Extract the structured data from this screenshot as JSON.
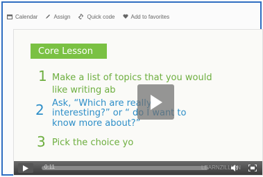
{
  "toolbar": {
    "calendar": "Calendar",
    "assign": "Assign",
    "quick_code": "Quick code",
    "favorites": "Add to favorites"
  },
  "lesson": {
    "tag": "Core Lesson",
    "steps": [
      {
        "num": "1",
        "lines": [
          "Make a list of topics that you would",
          "like writing ab"
        ]
      },
      {
        "num": "2",
        "lines": [
          "Ask, “Which          are really",
          "interesting?” or “     do I want to",
          "know more about?”"
        ]
      },
      {
        "num": "3",
        "lines": [
          "Pick the choice yo"
        ]
      }
    ]
  },
  "player": {
    "time": "0:11",
    "brand": "LEARNZILLION"
  },
  "colors": {
    "frame_border": "#2d6cc0",
    "tag_bg": "#7ac143",
    "green_text": "#6dae3f",
    "blue_text": "#2d8ec8"
  }
}
